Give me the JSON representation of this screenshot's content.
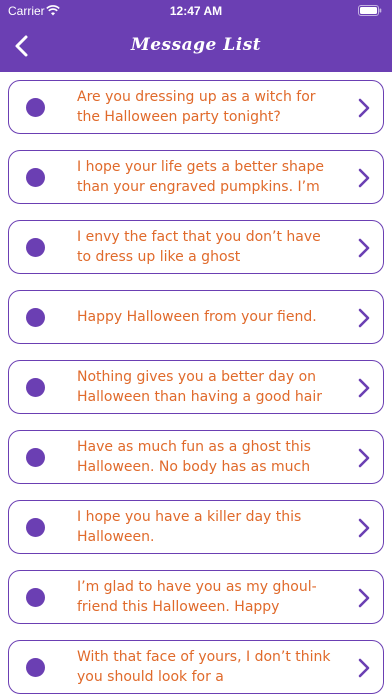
{
  "status": {
    "carrier": "Carrier",
    "time": "12:47 AM"
  },
  "nav": {
    "title": "Message List"
  },
  "colors": {
    "accent": "#6b3fb3",
    "text": "#e06a2b"
  },
  "messages": [
    {
      "text": "Are you dressing up as a witch for the Halloween party tonight?"
    },
    {
      "text": "I hope your life gets a better shape than your engraved pumpkins. I’m"
    },
    {
      "text": "I envy the fact that you don’t have to dress up like a ghost"
    },
    {
      "text": "Happy Halloween from your fiend."
    },
    {
      "text": "Nothing gives you a better day on Halloween than having a good hair"
    },
    {
      "text": "Have as much fun as a ghost this Halloween. No body has as much"
    },
    {
      "text": "I hope you have a killer day this Halloween."
    },
    {
      "text": "I’m glad to have you as my ghoul-friend this Halloween. Happy"
    },
    {
      "text": "With that face of yours, I don’t think you should look for a"
    }
  ]
}
